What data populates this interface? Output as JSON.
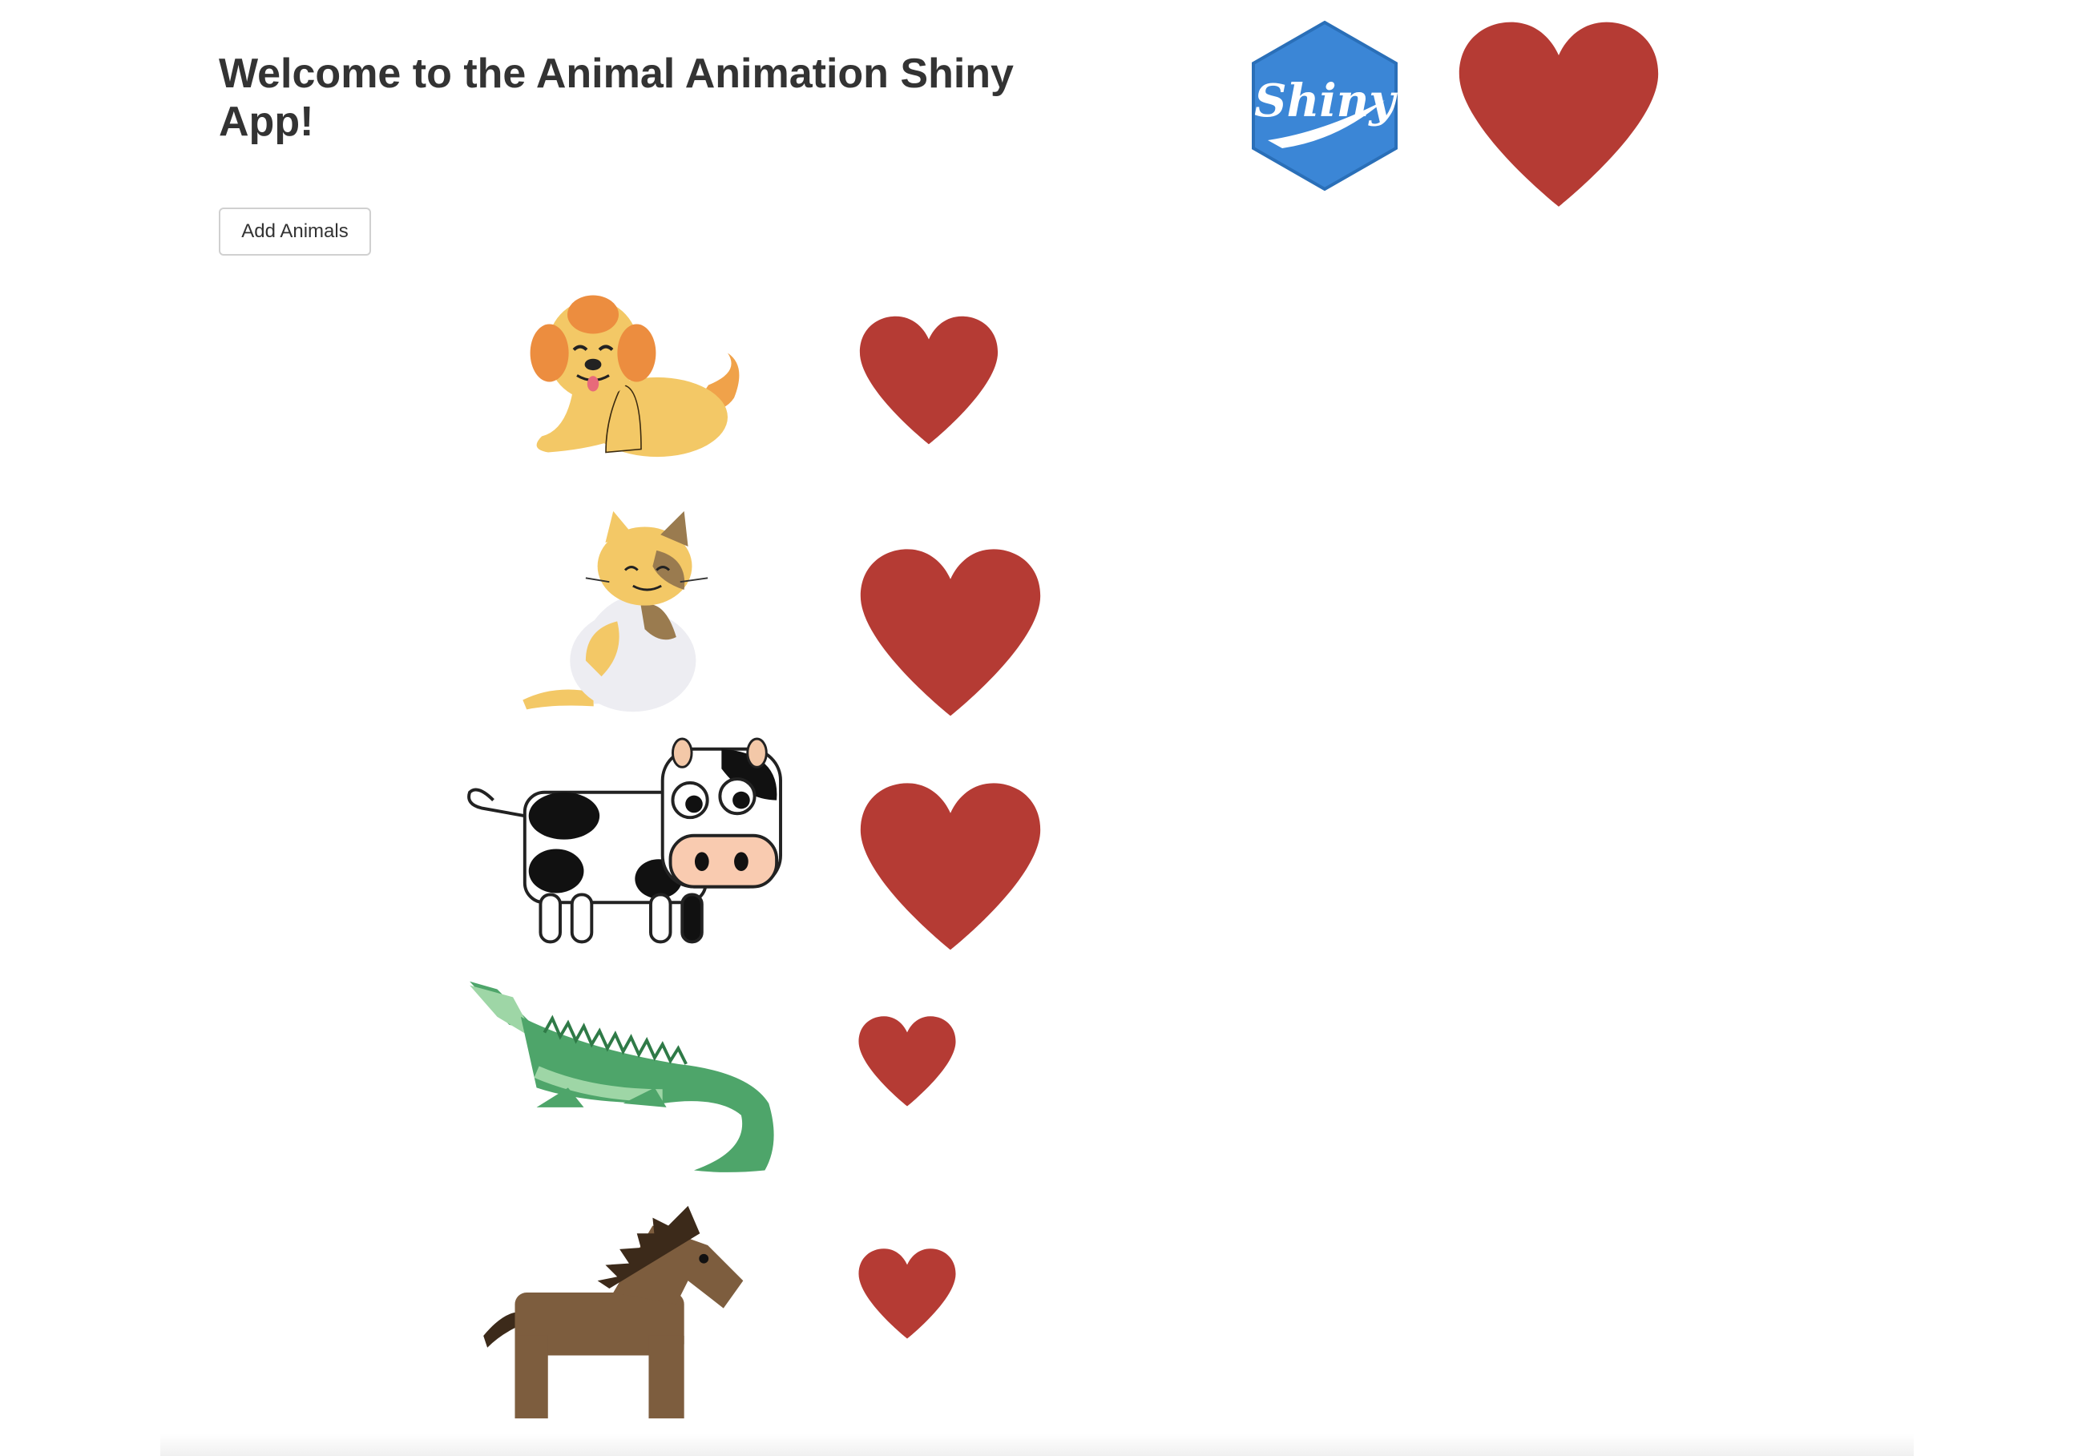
{
  "app": {
    "title": "Welcome to the Animal Animation Shiny App!"
  },
  "controls": {
    "add_animals_label": "Add Animals"
  },
  "logo": {
    "text": "Shiny",
    "color": "#3b86d6"
  },
  "colors": {
    "heart": "#b53b34",
    "background": "#ffffff",
    "title_text": "#333333"
  },
  "animals": [
    {
      "name": "dog"
    },
    {
      "name": "cat"
    },
    {
      "name": "cow"
    },
    {
      "name": "crocodile"
    },
    {
      "name": "horse"
    }
  ]
}
